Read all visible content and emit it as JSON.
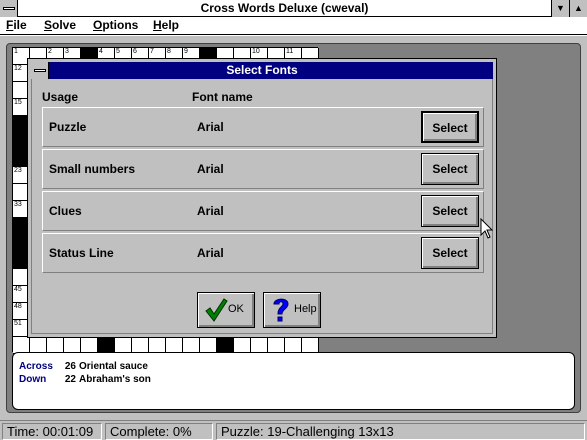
{
  "window": {
    "title": "Cross Words Deluxe (cweval)",
    "min_glyph": "▼",
    "max_glyph": "▲"
  },
  "menu": {
    "file": "File",
    "solve": "Solve",
    "options": "Options",
    "help": "Help"
  },
  "grid": {
    "top_numbers": [
      "1",
      "2",
      "3",
      "4",
      "5",
      "6",
      "7",
      "8",
      "9",
      "10",
      "11"
    ],
    "left_numbers": [
      "12",
      "15",
      "23",
      "33",
      "38",
      "45",
      "48",
      "51"
    ]
  },
  "dialog": {
    "title": "Select Fonts",
    "col_usage": "Usage",
    "col_font": "Font name",
    "rows": [
      {
        "usage": "Puzzle",
        "font": "Arial",
        "button": "Select"
      },
      {
        "usage": "Small numbers",
        "font": "Arial",
        "button": "Select"
      },
      {
        "usage": "Clues",
        "font": "Arial",
        "button": "Select"
      },
      {
        "usage": "Status Line",
        "font": "Arial",
        "button": "Select"
      }
    ],
    "ok_label": "OK",
    "help_label": "Help"
  },
  "clues": {
    "across": {
      "label": "Across",
      "number": "26",
      "text": "Oriental sauce"
    },
    "down": {
      "label": "Down",
      "number": "22",
      "text": "Abraham's son"
    }
  },
  "status": {
    "time": "Time: 00:01:09",
    "complete": "Complete: 0%",
    "puzzle": "Puzzle: 19-Challenging  13x13"
  },
  "colors": {
    "title_bar": "#000080",
    "clue_direction": "#000080",
    "check_icon": "#008000",
    "help_icon": "#0000ff"
  },
  "icons": [
    "system-menu-icon",
    "checkmark-icon",
    "question-mark-icon",
    "mouse-pointer-icon"
  ]
}
